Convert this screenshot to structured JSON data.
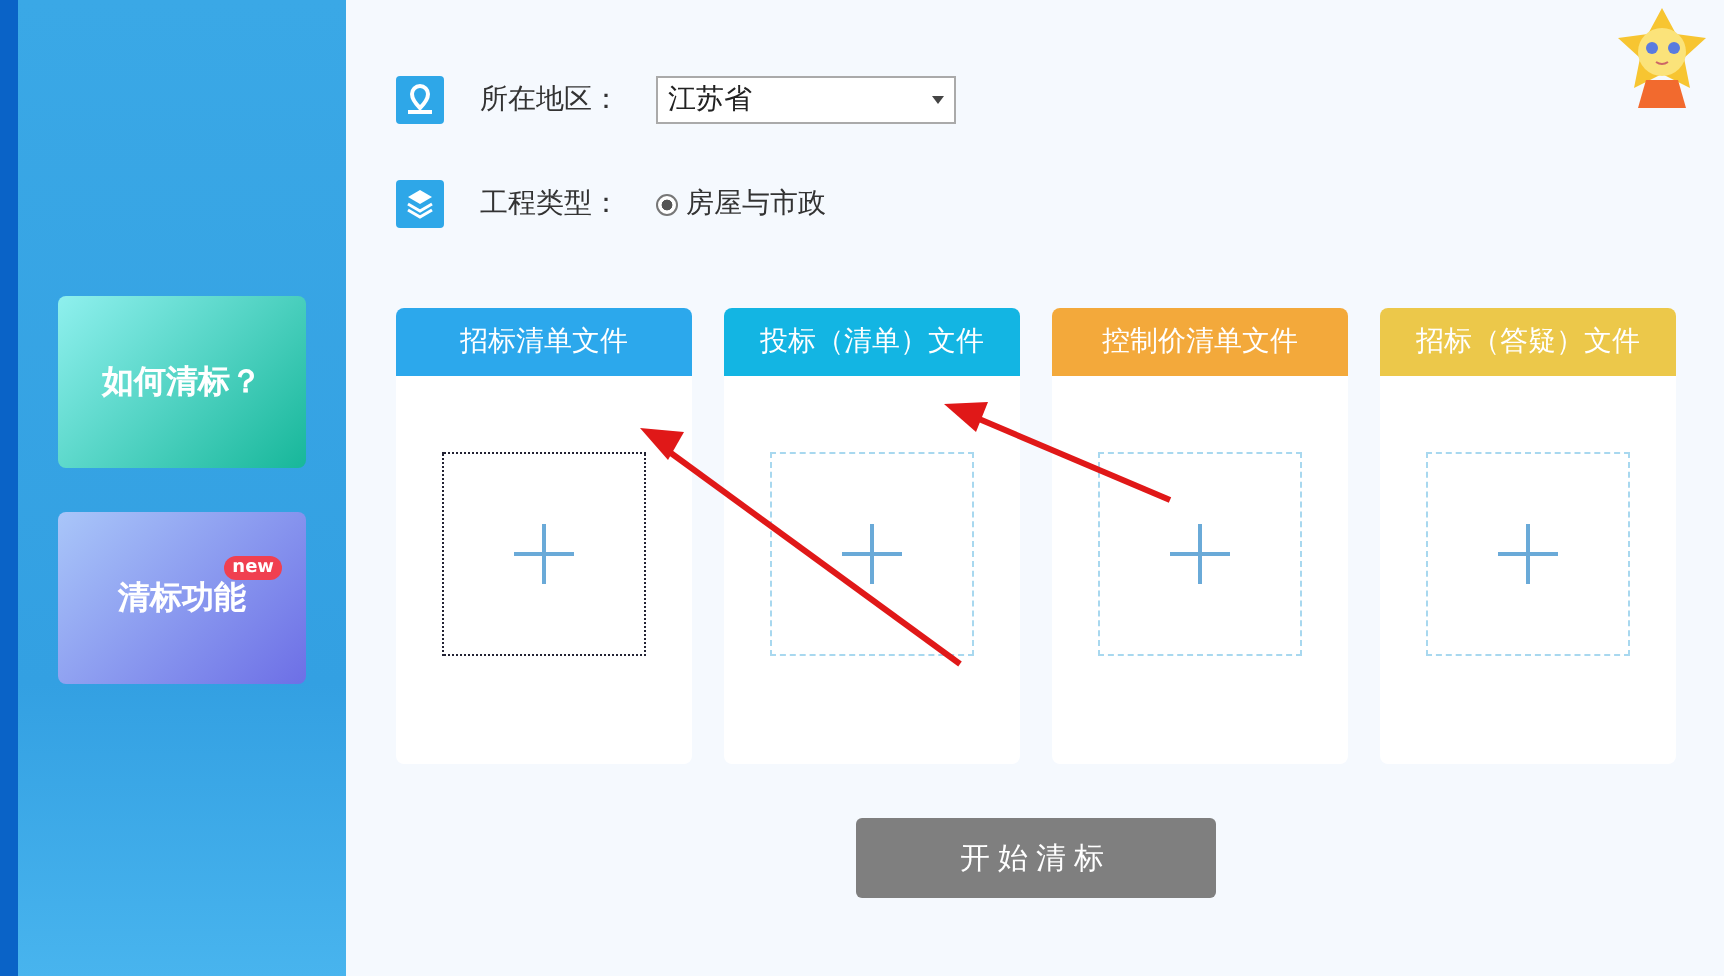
{
  "sidebar": {
    "items": [
      {
        "label": "如何清标？",
        "kind": "green"
      },
      {
        "label": "清标功能",
        "kind": "purple",
        "badge": "new"
      }
    ]
  },
  "form": {
    "region": {
      "label": "所在地区：",
      "value": "江苏省"
    },
    "project_type": {
      "label": "工程类型：",
      "options": [
        {
          "label": "房屋与市政",
          "selected": true
        }
      ]
    }
  },
  "file_cards": [
    {
      "title": "招标清单文件",
      "color": "#2ca8ec",
      "focused": true
    },
    {
      "title": "投标（清单）文件",
      "color": "#13b5e3",
      "focused": false
    },
    {
      "title": "控制价清单文件",
      "color": "#f3a93b",
      "focused": false
    },
    {
      "title": "招标（答疑）文件",
      "color": "#ecc84a",
      "focused": false
    }
  ],
  "start_button": {
    "label": "开始清标"
  }
}
